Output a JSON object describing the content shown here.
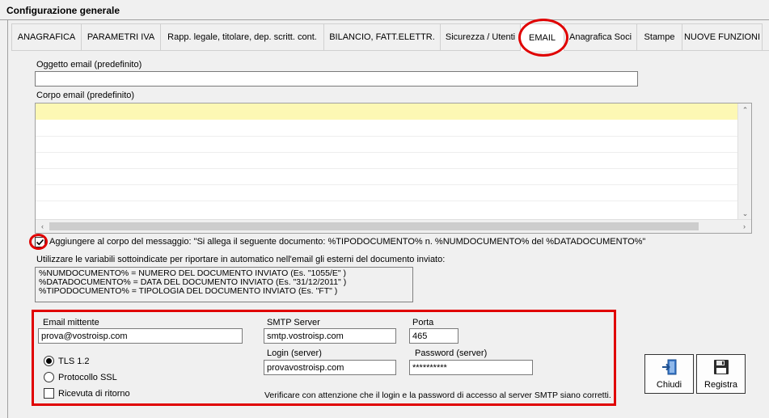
{
  "window": {
    "title": "Configurazione generale"
  },
  "tabs": [
    "ANAGRAFICA",
    "PARAMETRI IVA",
    "Rapp. legale, titolare, dep. scritt. cont.",
    "BILANCIO, FATT.ELETTR.",
    "Sicurezza / Utenti",
    "EMAIL",
    "Anagrafica Soci",
    "Stampe",
    "NUOVE FUNZIONI"
  ],
  "active_tab": "EMAIL",
  "email": {
    "subject_label": "Oggetto email (predefinito)",
    "subject_value": "",
    "body_label": "Corpo email (predefinito)",
    "body_value": "",
    "attach_checkbox_label": "Aggiungere al corpo del messaggio: \"Si allega il seguente documento: %TIPODOCUMENTO%  n.  %NUMDOCUMENTO%  del %DATADOCUMENTO%\"",
    "attach_checked": true,
    "vars_hint": "Utilizzare le variabili sottoindicate per riportare in automatico nell'email gli esterni del documento inviato:",
    "vars": [
      "%NUMDOCUMENTO% = NUMERO DEL DOCUMENTO INVIATO (Es. \"1055/E\" )",
      "%DATADOCUMENTO% = DATA DEL DOCUMENTO INVIATO (Es. \"31/12/2011\" )",
      "%TIPODOCUMENTO% = TIPOLOGIA DEL DOCUMENTO INVIATO (Es. \"FT\" )"
    ]
  },
  "smtp": {
    "sender_label": "Email mittente",
    "sender_value": "prova@vostroisp.com",
    "server_label": "SMTP Server",
    "server_value": "smtp.vostroisp.com",
    "port_label": "Porta",
    "port_value": "465",
    "login_label": "Login (server)",
    "login_value": "provavostroisp.com",
    "password_label": "Password  (server)",
    "password_value": "**********",
    "tls_label": "TLS 1.2",
    "ssl_label": "Protocollo SSL",
    "selected_protocol": "TLS 1.2",
    "receipt_label": "Ricevuta di ritorno",
    "receipt_checked": false,
    "note": "Verificare con attenzione che il login e la password di accesso al server SMTP siano corretti."
  },
  "buttons": {
    "close": "Chiudi",
    "save": "Registra"
  },
  "colors": {
    "highlight_annotation": "#e00000",
    "body_first_line": "#fdf8b4"
  }
}
